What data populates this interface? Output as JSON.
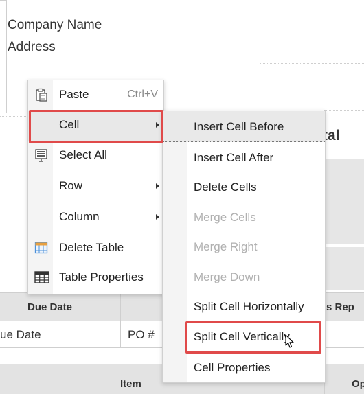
{
  "document": {
    "company_name": "Company Name",
    "address": "Address",
    "total_title": "tal",
    "headers": {
      "due_date": "Due Date",
      "sales_rep": "s Rep"
    },
    "values": {
      "due_date": "ue Date",
      "po": "PO #"
    },
    "item_headers": {
      "item": "Item",
      "option": "Op"
    }
  },
  "context_menu": {
    "items": [
      {
        "label": "Paste",
        "shortcut": "Ctrl+V",
        "icon": "clipboard-icon"
      },
      {
        "label": "Cell",
        "submenu": true,
        "highlighted": true
      },
      {
        "label": "Select All",
        "icon": "select-all-icon"
      },
      {
        "label": "Row",
        "submenu": true
      },
      {
        "label": "Column",
        "submenu": true
      },
      {
        "label": "Delete Table",
        "icon": "delete-table-icon"
      },
      {
        "label": "Table Properties",
        "icon": "table-properties-icon"
      }
    ]
  },
  "cell_submenu": {
    "items": [
      {
        "label": "Insert Cell Before",
        "enabled": true,
        "hovered": true
      },
      {
        "label": "Insert Cell After",
        "enabled": true
      },
      {
        "label": "Delete Cells",
        "enabled": true
      },
      {
        "label": "Merge Cells",
        "enabled": false
      },
      {
        "label": "Merge Right",
        "enabled": false
      },
      {
        "label": "Merge Down",
        "enabled": false
      },
      {
        "label": "Split Cell Horizontally",
        "enabled": true
      },
      {
        "label": "Split Cell Vertically",
        "enabled": true,
        "highlighted": true
      },
      {
        "label": "Cell Properties",
        "enabled": true
      }
    ]
  },
  "colors": {
    "highlight_outline": "#e04a4a",
    "disabled_text": "#b0b0b0",
    "header_background": "#e3e3e3"
  }
}
